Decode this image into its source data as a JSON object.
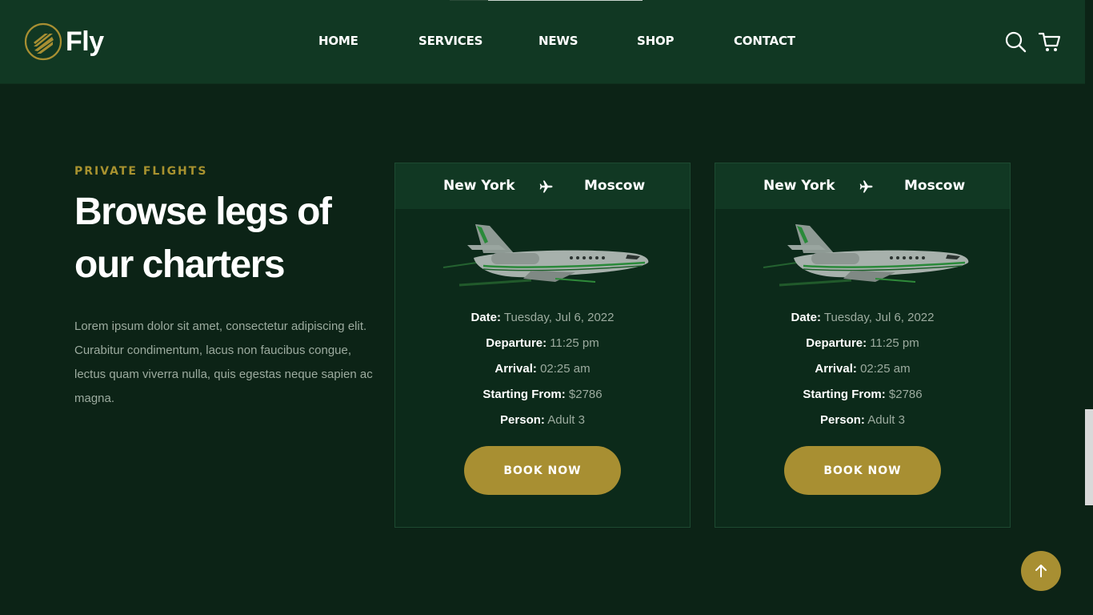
{
  "brand": {
    "name": "Fly"
  },
  "nav": {
    "items": [
      {
        "label": "HOME"
      },
      {
        "label": "SERVICES"
      },
      {
        "label": "NEWS"
      },
      {
        "label": "SHOP"
      },
      {
        "label": "CONTACT"
      }
    ]
  },
  "icons": {
    "search": "search-icon",
    "cart": "cart-icon",
    "scroll_top": "arrow-up-icon"
  },
  "colors": {
    "accent": "#a88f32",
    "header_bg": "#113823",
    "page_bg": "#0c2316"
  },
  "intro": {
    "eyebrow": "PRIVATE FLIGHTS",
    "headline": "Browse legs of our charters",
    "body": "Lorem ipsum dolor sit amet, consectetur adipiscing elit. Curabitur condimentum, lacus non faucibus congue, lectus quam viverra nulla, quis egestas neque sapien ac magna."
  },
  "cards": [
    {
      "from": "New York",
      "to": "Moscow",
      "details": [
        {
          "label": "Date:",
          "value": "Tuesday, Jul 6, 2022"
        },
        {
          "label": "Departure:",
          "value": "11:25 pm"
        },
        {
          "label": "Arrival:",
          "value": "02:25 am"
        },
        {
          "label": "Starting From:",
          "value": "$2786"
        },
        {
          "label": "Person:",
          "value": "Adult 3"
        }
      ],
      "button": "BOOK NOW"
    },
    {
      "from": "New York",
      "to": "Moscow",
      "details": [
        {
          "label": "Date:",
          "value": "Tuesday, Jul 6, 2022"
        },
        {
          "label": "Departure:",
          "value": "11:25 pm"
        },
        {
          "label": "Arrival:",
          "value": "02:25 am"
        },
        {
          "label": "Starting From:",
          "value": "$2786"
        },
        {
          "label": "Person:",
          "value": "Adult 3"
        }
      ],
      "button": "BOOK NOW"
    }
  ]
}
